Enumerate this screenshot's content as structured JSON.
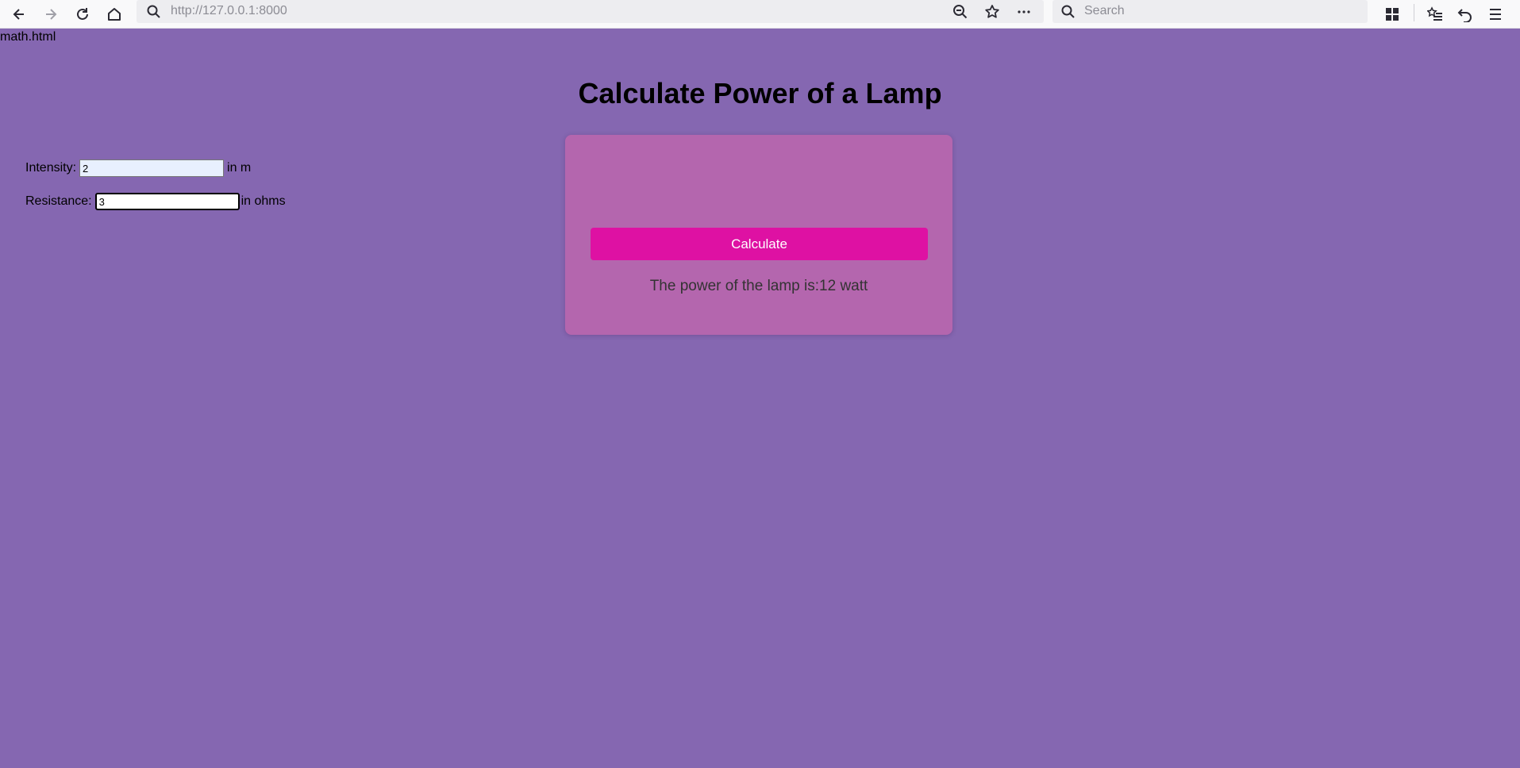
{
  "browser": {
    "url_prefix": "http://",
    "url_host": "127.0.0.1",
    "url_port": ":8000",
    "search_placeholder": "Search"
  },
  "page": {
    "filename": "math.html",
    "title": "Calculate Power of a Lamp",
    "form": {
      "intensity_label": "Intensity:",
      "intensity_value": "2",
      "intensity_unit": "in m",
      "resistance_label": "Resistance:",
      "resistance_value": "3",
      "resistance_unit": "in ohms",
      "button_label": "Calculate"
    },
    "result_text": "The power of the lamp is:12 watt"
  },
  "colors": {
    "page_bg": "#8567b1",
    "card_bg": "#b466ae",
    "button_bg": "#de11a3"
  }
}
